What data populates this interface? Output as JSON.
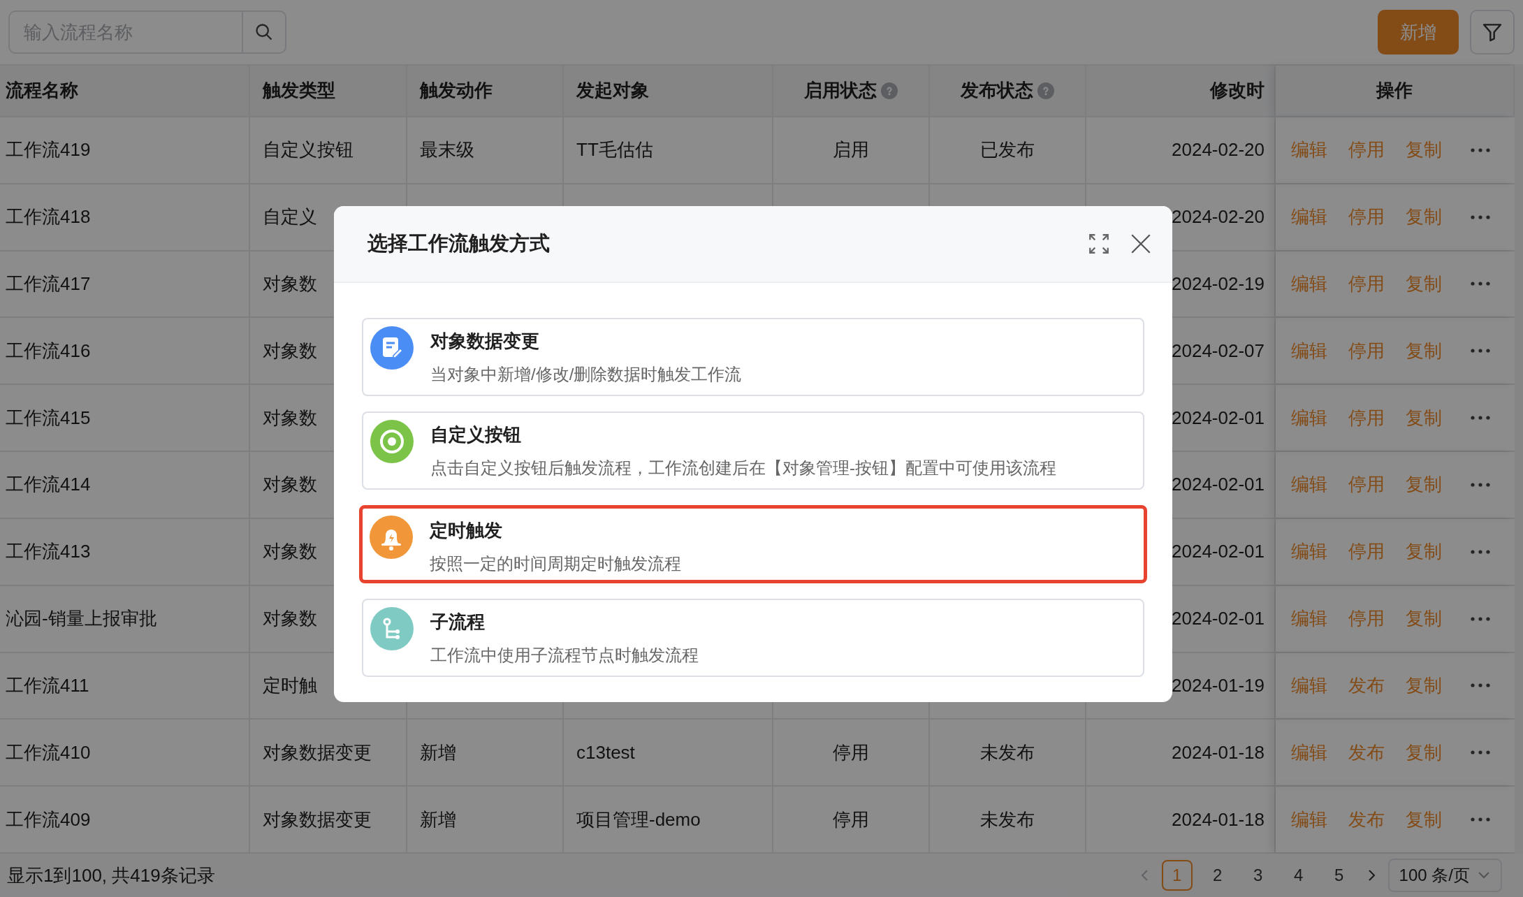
{
  "toolbar": {
    "search": {
      "placeholder": "输入流程名称"
    },
    "add_button": "新增"
  },
  "table": {
    "columns": [
      {
        "label": "流程名称"
      },
      {
        "label": "触发类型"
      },
      {
        "label": "触发动作"
      },
      {
        "label": "发起对象"
      },
      {
        "label": "启用状态",
        "help": true
      },
      {
        "label": "发布状态",
        "help": true
      },
      {
        "label": "修改时"
      },
      {
        "label": "操作"
      }
    ],
    "rows": [
      {
        "name": "工作流419",
        "type": "自定义按钮",
        "action": "最末级",
        "object": "TT毛估估",
        "enabled": "启用",
        "published": "已发布",
        "modified": "2024-02-20",
        "actions": [
          "编辑",
          "停用",
          "复制"
        ]
      },
      {
        "name": "工作流418",
        "type": "自定义",
        "modified": "2024-02-20",
        "actions": [
          "编辑",
          "停用",
          "复制"
        ]
      },
      {
        "name": "工作流417",
        "type": "对象数",
        "modified": "2024-02-19",
        "actions": [
          "编辑",
          "停用",
          "复制"
        ]
      },
      {
        "name": "工作流416",
        "type": "对象数",
        "modified": "2024-02-07",
        "actions": [
          "编辑",
          "停用",
          "复制"
        ]
      },
      {
        "name": "工作流415",
        "type": "对象数",
        "modified": "2024-02-01",
        "actions": [
          "编辑",
          "停用",
          "复制"
        ]
      },
      {
        "name": "工作流414",
        "type": "对象数",
        "modified": "2024-02-01",
        "actions": [
          "编辑",
          "停用",
          "复制"
        ]
      },
      {
        "name": "工作流413",
        "type": "对象数",
        "modified": "2024-02-01",
        "actions": [
          "编辑",
          "停用",
          "复制"
        ]
      },
      {
        "name": "沁园-销量上报审批",
        "type": "对象数",
        "modified": "2024-02-01",
        "actions": [
          "编辑",
          "停用",
          "复制"
        ]
      },
      {
        "name": "工作流411",
        "type": "定时触",
        "modified": "2024-01-19",
        "actions": [
          "编辑",
          "发布",
          "复制"
        ]
      },
      {
        "name": "工作流410",
        "type": "对象数据变更",
        "action": "新增",
        "object": "c13test",
        "enabled": "停用",
        "published": "未发布",
        "modified": "2024-01-18",
        "actions": [
          "编辑",
          "发布",
          "复制"
        ]
      },
      {
        "name": "工作流409",
        "type": "对象数据变更",
        "action": "新增",
        "object": "项目管理-demo",
        "enabled": "停用",
        "published": "未发布",
        "modified": "2024-01-18",
        "actions": [
          "编辑",
          "发布",
          "复制"
        ]
      }
    ]
  },
  "footer": {
    "summary": "显示1到100, 共419条记录",
    "pages": [
      {
        "label": "1",
        "selected": true
      },
      {
        "label": "2",
        "selected": false
      },
      {
        "label": "3",
        "selected": false
      },
      {
        "label": "4",
        "selected": false
      },
      {
        "label": "5",
        "selected": false
      }
    ],
    "page_size": "100 条/页"
  },
  "dialog": {
    "title": "选择工作流触发方式",
    "options": [
      {
        "kind": "edit",
        "color": "#4a8ef5",
        "title": "对象数据变更",
        "description": "当对象中新增/修改/删除数据时触发工作流",
        "selected": false
      },
      {
        "kind": "target",
        "color": "#7cc447",
        "title": "自定义按钮",
        "description": "点击自定义按钮后触发流程，工作流创建后在【对象管理-按钮】配置中可使用该流程",
        "selected": false
      },
      {
        "kind": "bell",
        "color": "#f2963a",
        "title": "定时触发",
        "description": "按照一定的时间周期定时触发流程",
        "selected": true
      },
      {
        "kind": "branch",
        "color": "#7fcbc4",
        "title": "子流程",
        "description": "工作流中使用子流程节点时触发流程",
        "selected": false
      }
    ]
  }
}
